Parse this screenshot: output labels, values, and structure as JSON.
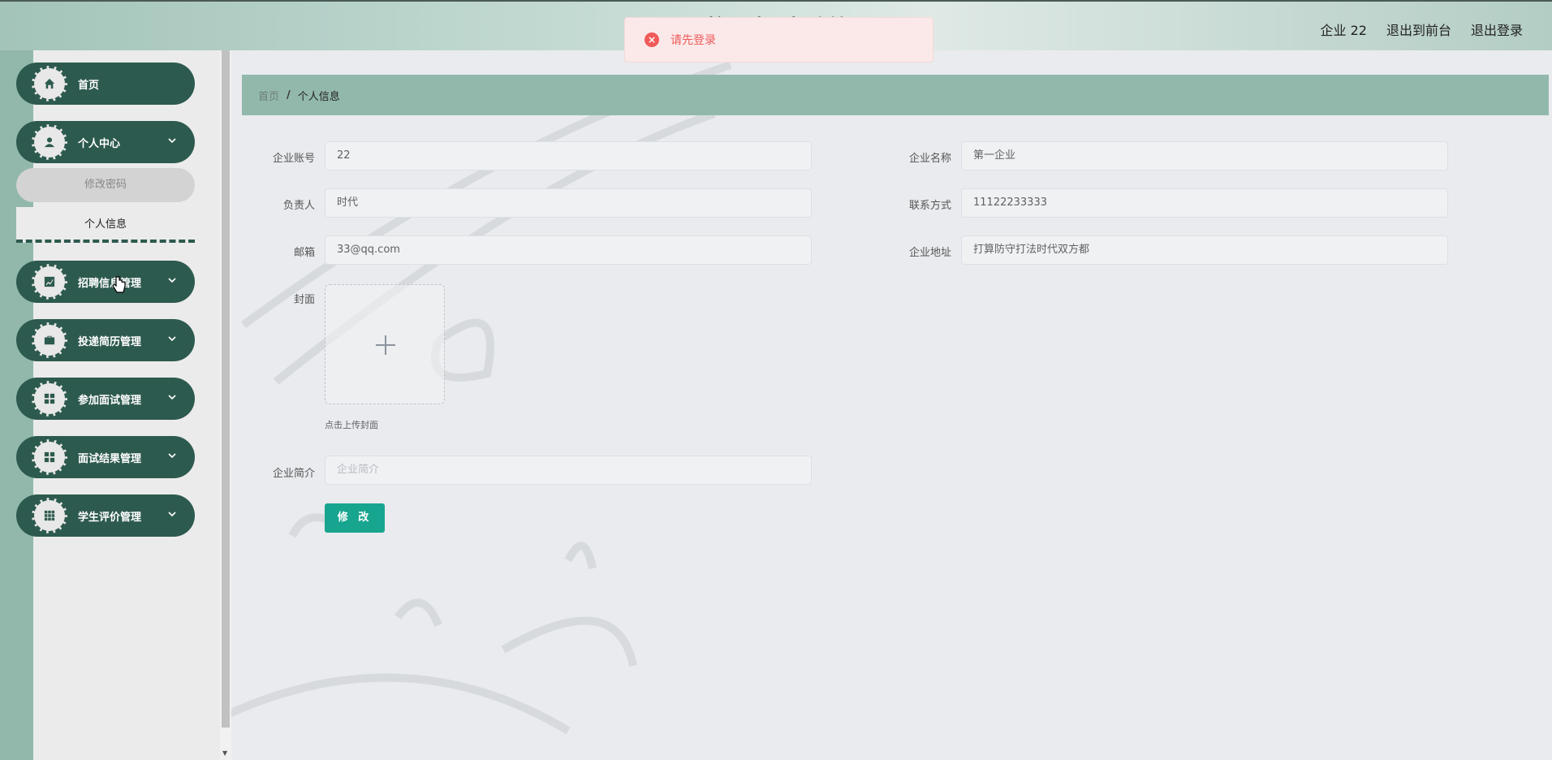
{
  "header": {
    "title": "校园招聘系统",
    "nav": [
      "企业 22",
      "退出到前台",
      "退出登录"
    ]
  },
  "toast": {
    "icon": "error-circle-icon",
    "message": "请先登录",
    "color": "#f05a5a"
  },
  "sidebar": {
    "items": [
      {
        "label": "首页",
        "icon": "home-icon",
        "expandable": false
      },
      {
        "label": "个人中心",
        "icon": "user-icon",
        "expandable": true
      },
      {
        "label": "招聘信息管理",
        "icon": "chart-icon",
        "expandable": true
      },
      {
        "label": "投递简历管理",
        "icon": "briefcase-icon",
        "expandable": true
      },
      {
        "label": "参加面试管理",
        "icon": "grid-icon",
        "expandable": true
      },
      {
        "label": "面试结果管理",
        "icon": "grid-icon",
        "expandable": true
      },
      {
        "label": "学生评价管理",
        "icon": "apps-icon",
        "expandable": true
      }
    ],
    "submenu": {
      "change_password": "修改密码",
      "profile": "个人信息"
    }
  },
  "breadcrumb": {
    "home": "首页",
    "separator": "/",
    "current": "个人信息"
  },
  "form": {
    "account": {
      "label": "企业账号",
      "value": "22"
    },
    "company_name": {
      "label": "企业名称",
      "value": "第一企业"
    },
    "manager": {
      "label": "负责人",
      "value": "时代"
    },
    "contact": {
      "label": "联系方式",
      "value": "11122233333"
    },
    "email": {
      "label": "邮箱",
      "value": "33@qq.com"
    },
    "address": {
      "label": "企业地址",
      "value": "打算防守打法时代双方都"
    },
    "cover": {
      "label": "封面",
      "hint": "点击上传封面"
    },
    "intro": {
      "label": "企业简介",
      "placeholder": "企业简介"
    },
    "submit_label": "修 改"
  },
  "colors": {
    "accent": "#2d5a4e",
    "rail": "#92b8ac",
    "button": "#18a58f"
  }
}
